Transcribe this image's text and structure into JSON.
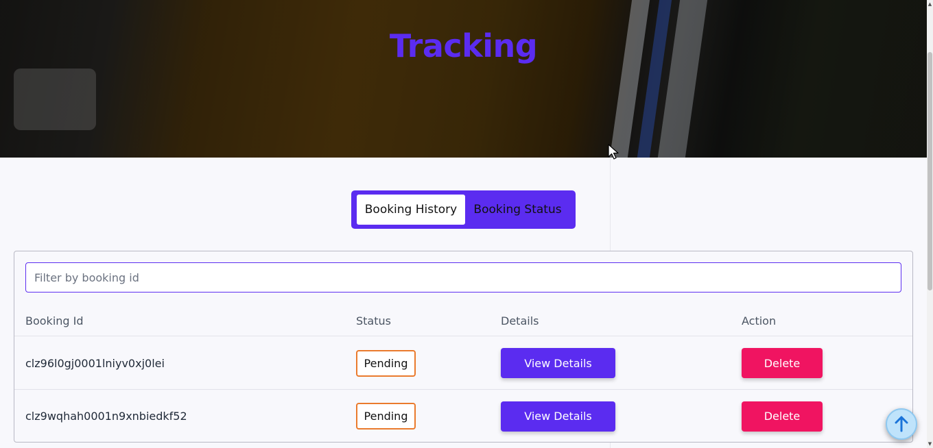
{
  "hero": {
    "title": "Tracking"
  },
  "tabs": {
    "history_label": "Booking History",
    "status_label": "Booking Status"
  },
  "filter": {
    "placeholder": "Filter by booking id",
    "value": ""
  },
  "table": {
    "headers": {
      "booking_id": "Booking Id",
      "status": "Status",
      "details": "Details",
      "action": "Action"
    },
    "rows": [
      {
        "booking_id": "clz96l0gj0001lniyv0xj0lei",
        "status": "Pending",
        "details_label": "View Details",
        "action_label": "Delete"
      },
      {
        "booking_id": "clz9wqhah0001n9xnbiedkf52",
        "status": "Pending",
        "details_label": "View Details",
        "action_label": "Delete"
      }
    ]
  },
  "icons": {
    "scroll_top": "arrow-up-icon",
    "cursor": "mouse-pointer-icon"
  },
  "colors": {
    "accent": "#5b2cf0",
    "danger": "#f01461",
    "pending_border": "#ea7a2c",
    "scroll_top_bg": "#bfe3fb"
  }
}
